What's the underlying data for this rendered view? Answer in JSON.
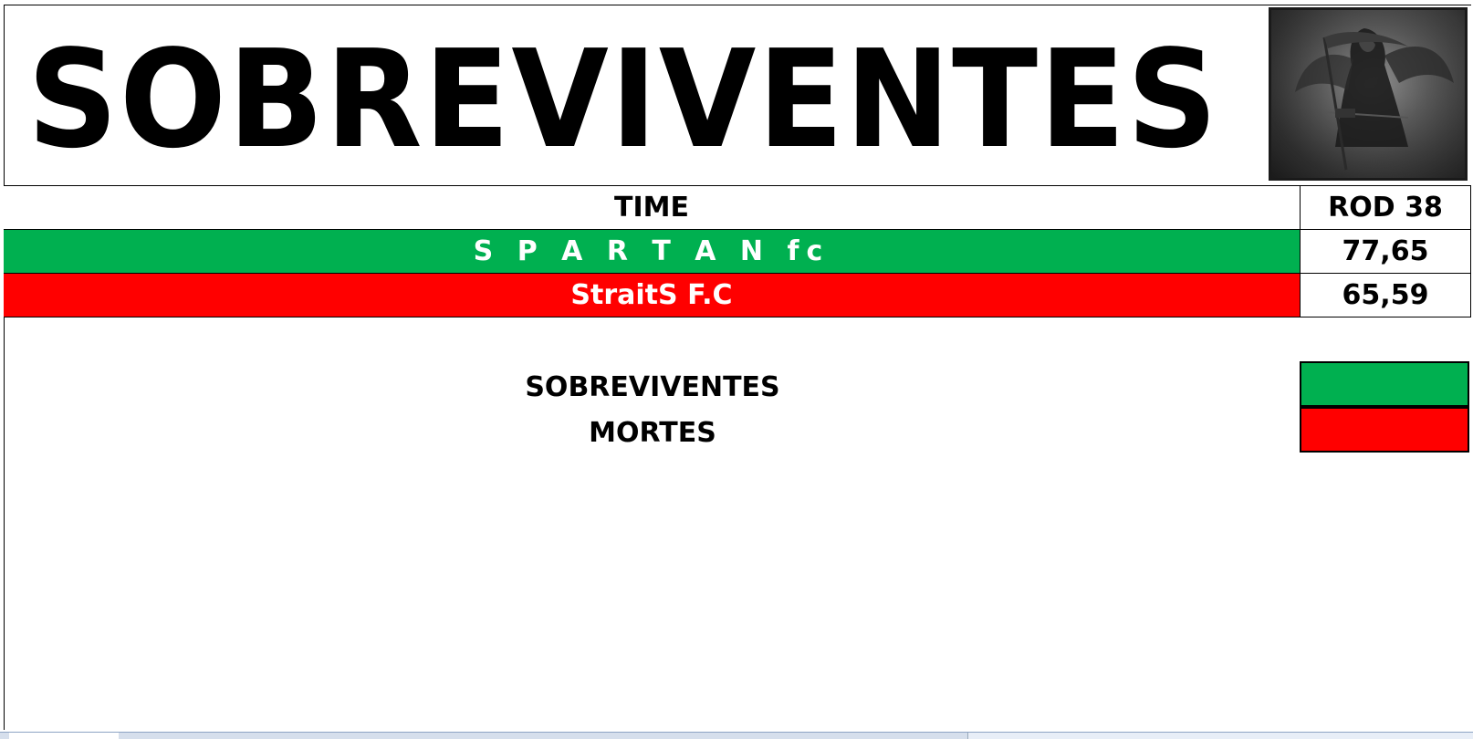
{
  "title": "SOBREVIVENTES",
  "table": {
    "header": {
      "team": "TIME",
      "score": "ROD 38"
    },
    "rows": [
      {
        "team": "S P A R T A N fc",
        "score": "77,65",
        "status_color": "#00b050"
      },
      {
        "team": "StraitS F.C",
        "score": "65,59",
        "status_color": "#ff0000"
      }
    ]
  },
  "legend": {
    "items": [
      {
        "label": "SOBREVIVENTES",
        "color": "#00b050"
      },
      {
        "label": "MORTES",
        "color": "#ff0000"
      }
    ]
  },
  "image": {
    "icon": "grim-reaper-image"
  },
  "sheet_tabs": {
    "count": 3
  }
}
